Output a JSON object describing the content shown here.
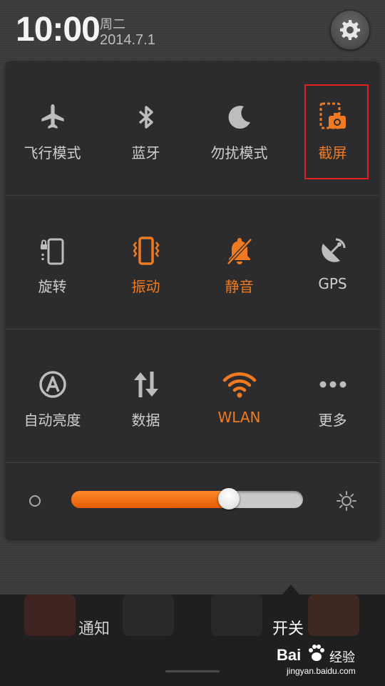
{
  "status": {
    "time": "10:00",
    "weekday": "周二",
    "date": "2014.7.1"
  },
  "settings": {
    "icon": "gear-icon"
  },
  "toggles": [
    {
      "label": "飞行模式",
      "icon": "airplane-icon",
      "active": false
    },
    {
      "label": "蓝牙",
      "icon": "bluetooth-icon",
      "active": false
    },
    {
      "label": "勿扰模式",
      "icon": "moon-icon",
      "active": false
    },
    {
      "label": "截屏",
      "icon": "screenshot-icon",
      "active": true
    },
    {
      "label": "旋转",
      "icon": "rotation-lock-icon",
      "active": false
    },
    {
      "label": "振动",
      "icon": "vibrate-icon",
      "active": true
    },
    {
      "label": "静音",
      "icon": "mute-icon",
      "active": true
    },
    {
      "label": "GPS",
      "icon": "gps-icon",
      "active": false
    },
    {
      "label": "自动亮度",
      "icon": "auto-brightness-icon",
      "active": false
    },
    {
      "label": "数据",
      "icon": "data-sync-icon",
      "active": false
    },
    {
      "label": "WLAN",
      "icon": "wifi-icon",
      "active": true
    },
    {
      "label": "更多",
      "icon": "more-icon",
      "active": false
    }
  ],
  "brightness": {
    "level": 0.68
  },
  "tabs": {
    "notifications": "通知",
    "toggles": "开关",
    "active": "toggles"
  },
  "watermark": {
    "brand": "Bai",
    "brand2": "经验",
    "url": "jingyan.baidu.com"
  },
  "colors": {
    "accent": "#f07a22",
    "highlight_box": "#e0201e"
  }
}
